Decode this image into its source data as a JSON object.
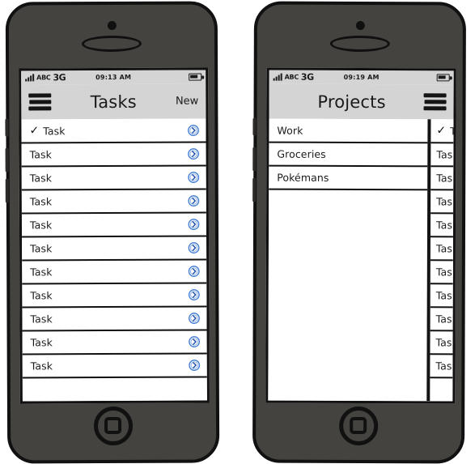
{
  "phones": [
    {
      "id": "phone-tasks",
      "status_bar": {
        "signal_icon": "signal-bars-icon",
        "carrier": "ABC",
        "network": "3G",
        "time": "09:13 AM",
        "battery_icon": "battery-icon"
      },
      "nav": {
        "menu_icon": "hamburger-menu-icon",
        "title": "Tasks",
        "action_label": "New"
      },
      "list": {
        "disclosure_icon": "chevron-circle-right-icon",
        "check_icon": "✓",
        "rows": [
          {
            "label": "Task",
            "checked": true
          },
          {
            "label": "Task",
            "checked": false
          },
          {
            "label": "Task",
            "checked": false
          },
          {
            "label": "Task",
            "checked": false
          },
          {
            "label": "Task",
            "checked": false
          },
          {
            "label": "Task",
            "checked": false
          },
          {
            "label": "Task",
            "checked": false
          },
          {
            "label": "Task",
            "checked": false
          },
          {
            "label": "Task",
            "checked": false
          },
          {
            "label": "Task",
            "checked": false
          },
          {
            "label": "Task",
            "checked": false
          }
        ]
      },
      "drawer": null
    },
    {
      "id": "phone-projects",
      "status_bar": {
        "signal_icon": "signal-bars-icon",
        "carrier": "ABC",
        "network": "3G",
        "time": "09:19 AM",
        "battery_icon": "battery-icon"
      },
      "nav": {
        "menu_icon": "hamburger-menu-icon",
        "title": "Projects",
        "action_label": ""
      },
      "list": {
        "rows": [
          {
            "label": "Work",
            "checked": false
          },
          {
            "label": "Groceries",
            "checked": false
          },
          {
            "label": "Pokémans",
            "checked": false
          }
        ]
      },
      "drawer": {
        "check_icon": "✓",
        "rows": [
          {
            "label": "Task",
            "checked": true
          },
          {
            "label": "Task",
            "checked": false
          },
          {
            "label": "Task",
            "checked": false
          },
          {
            "label": "Task",
            "checked": false
          },
          {
            "label": "Task",
            "checked": false
          },
          {
            "label": "Task",
            "checked": false
          },
          {
            "label": "Task",
            "checked": false
          },
          {
            "label": "Task",
            "checked": false
          },
          {
            "label": "Task",
            "checked": false
          },
          {
            "label": "Task",
            "checked": false
          },
          {
            "label": "Task",
            "checked": false
          }
        ]
      }
    }
  ],
  "hardware": {
    "camera_icon": "front-camera-icon",
    "speaker_icon": "earpiece-speaker-icon",
    "home_button_icon": "home-button-icon"
  },
  "colors": {
    "body": "#454340",
    "outline": "#111111",
    "navbar": "#d4d4d4",
    "screen": "#ffffff",
    "accent": "#3b79d4",
    "text": "#1a1a1a"
  }
}
